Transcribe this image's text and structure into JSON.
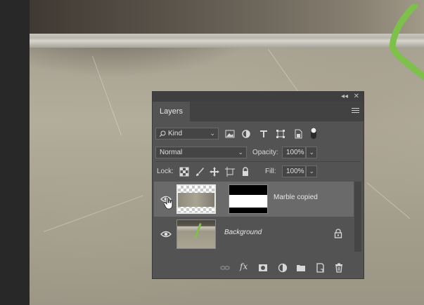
{
  "panel": {
    "tab_label": "Layers",
    "title_controls": {
      "collapse": "◂◂",
      "close": "✕"
    }
  },
  "filter": {
    "kind_label": "Kind",
    "icons": [
      "image-filter-icon",
      "adjustment-filter-icon",
      "type-filter-icon",
      "shape-filter-icon",
      "smart-object-filter-icon",
      "filter-toggle-icon"
    ]
  },
  "blend": {
    "mode": "Normal",
    "opacity_label": "Opacity:",
    "opacity_value": "100%"
  },
  "lock": {
    "label": "Lock:",
    "fill_label": "Fill:",
    "fill_value": "100%",
    "icons": [
      "lock-transparent-pixels-icon",
      "lock-image-pixels-icon",
      "lock-position-icon",
      "lock-artboard-icon",
      "lock-all-icon"
    ]
  },
  "layers": [
    {
      "name": "Marble copied",
      "selected": true,
      "visible": true,
      "has_mask": true,
      "locked": false
    },
    {
      "name": "Background",
      "selected": false,
      "visible": true,
      "has_mask": false,
      "locked": true
    }
  ],
  "bottom_icons": [
    "link-layers-icon",
    "fx-icon",
    "add-mask-icon",
    "adjustment-layer-icon",
    "new-group-icon",
    "new-layer-icon",
    "trash-icon"
  ],
  "bottom_fx_text": "fx",
  "colors": {
    "panel_bg": "#535353",
    "selected_row": "#6a6a6a",
    "green_stroke": "#7dc04a"
  }
}
